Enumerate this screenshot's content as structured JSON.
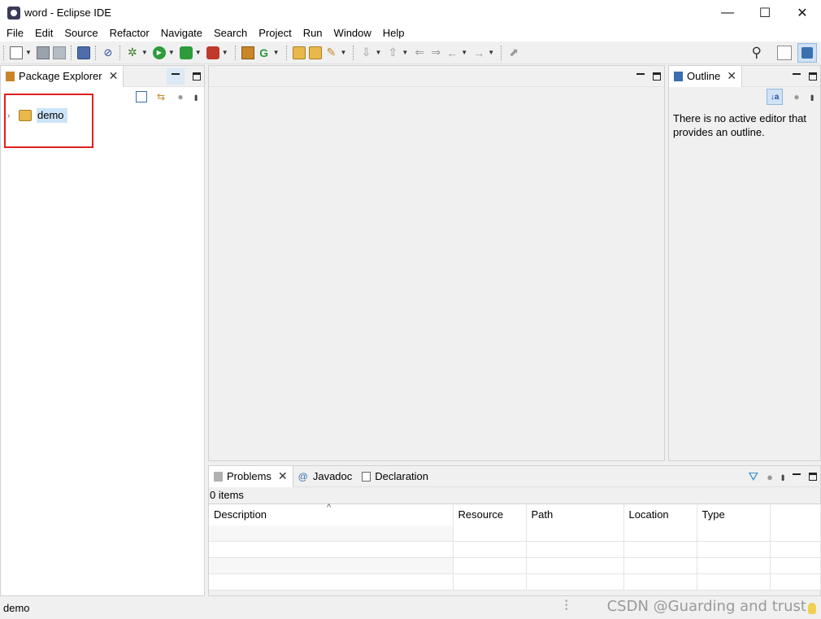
{
  "window": {
    "title": "word - Eclipse IDE",
    "controls": [
      "—",
      "☐",
      "✕"
    ]
  },
  "menu": [
    "File",
    "Edit",
    "Source",
    "Refactor",
    "Navigate",
    "Search",
    "Project",
    "Run",
    "Window",
    "Help"
  ],
  "package_explorer": {
    "tab_label": "Package Explorer",
    "tree": [
      {
        "label": "demo",
        "expanded": false
      }
    ]
  },
  "outline": {
    "tab_label": "Outline",
    "message": "There is no active editor that provides an outline."
  },
  "bottom_panel": {
    "tabs": [
      "Problems",
      "Javadoc",
      "Declaration"
    ],
    "items_count": "0 items",
    "columns": [
      "Description",
      "Resource",
      "Path",
      "Location",
      "Type"
    ],
    "row_count": 5
  },
  "statusbar": {
    "text": "demo"
  },
  "watermark": "CSDN @Guarding and trust",
  "colors": {
    "selection": "#cce4f7",
    "highlight_box": "#e02020"
  }
}
